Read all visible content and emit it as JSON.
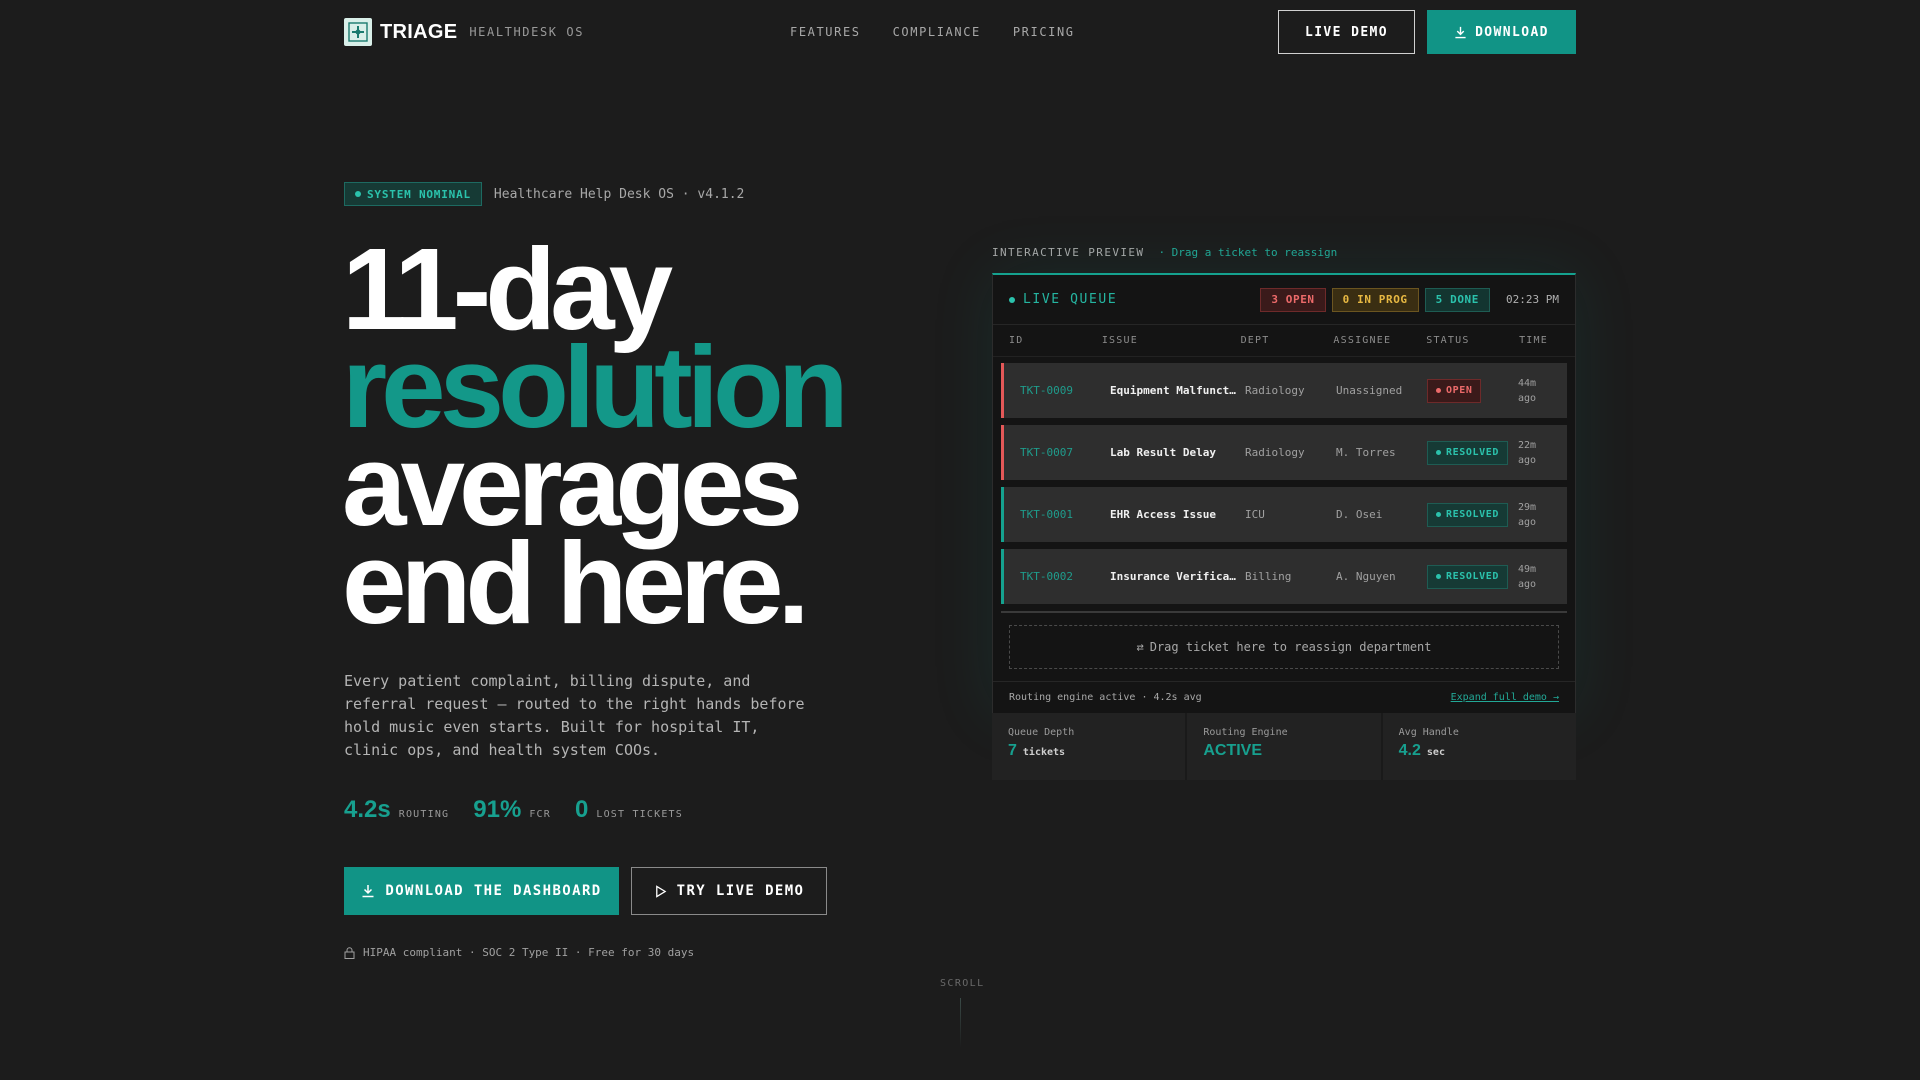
{
  "nav": {
    "brand": "TRIAGE",
    "brand_sub": "HEALTHDESK OS",
    "links": [
      "FEATURES",
      "COMPLIANCE",
      "PRICING"
    ],
    "live_demo": "LIVE DEMO",
    "download": "DOWNLOAD"
  },
  "hero": {
    "status_badge": "SYSTEM NOMINAL",
    "status_text": "Healthcare Help Desk OS · v4.1.2",
    "headline": [
      "11-day",
      "resolution",
      "averages",
      "end here."
    ],
    "lead": "Every patient complaint, billing dispute, and referral request — routed to the right hands before hold music even starts. Built for hospital IT, clinic ops, and health system COOs.",
    "stats": [
      {
        "value": "4.2s",
        "label": "ROUTING"
      },
      {
        "value": "91%",
        "label": "FCR"
      },
      {
        "value": "0",
        "label": "LOST TICKETS"
      }
    ],
    "cta_primary": "DOWNLOAD THE DASHBOARD",
    "cta_secondary": "TRY LIVE DEMO",
    "compliance": "HIPAA compliant · SOC 2 Type II · Free for 30 days",
    "scroll": "SCROLL"
  },
  "preview": {
    "label": "INTERACTIVE PREVIEW",
    "hint": "· Drag a ticket to reassign",
    "title": "LIVE QUEUE",
    "badges": {
      "open": "3 OPEN",
      "in_prog": "0 IN PROG",
      "done": "5 DONE"
    },
    "time": "02:23 PM",
    "columns": [
      "ID",
      "ISSUE",
      "DEPT",
      "ASSIGNEE",
      "STATUS",
      "TIME"
    ],
    "rows": [
      {
        "id": "TKT-0009",
        "issue": "Equipment Malfunction",
        "dept": "Radiology",
        "assignee": "Unassigned",
        "status": "OPEN",
        "time1": "44m",
        "time2": "ago"
      },
      {
        "id": "TKT-0007",
        "issue": "Lab Result Delay",
        "dept": "Radiology",
        "assignee": "M. Torres",
        "status": "RESOLVED",
        "time1": "22m",
        "time2": "ago"
      },
      {
        "id": "TKT-0001",
        "issue": "EHR Access Issue",
        "dept": "ICU",
        "assignee": "D. Osei",
        "status": "RESOLVED",
        "time1": "29m",
        "time2": "ago"
      },
      {
        "id": "TKT-0002",
        "issue": "Insurance Verification",
        "dept": "Billing",
        "assignee": "A. Nguyen",
        "status": "RESOLVED",
        "time1": "49m",
        "time2": "ago"
      }
    ],
    "dropzone": "Drag ticket here to reassign department",
    "footer_text": "Routing engine active · 4.2s avg",
    "footer_link": "Expand full demo →"
  },
  "metrics": [
    {
      "label": "Queue Depth",
      "value": "7",
      "unit": "tickets"
    },
    {
      "label": "Routing Engine",
      "value": "ACTIVE",
      "unit": ""
    },
    {
      "label": "Avg Handle",
      "value": "4.2",
      "unit": "sec"
    }
  ],
  "colors": {
    "accent": "#119486",
    "open": "#ec6a6a",
    "in_prog": "#e7b842",
    "done": "#2bc2ac",
    "bg": "#1c1c1c"
  }
}
